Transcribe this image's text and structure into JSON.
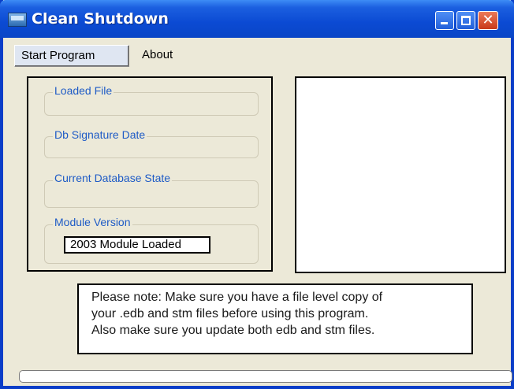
{
  "window": {
    "title": "Clean Shutdown"
  },
  "menu": {
    "start_program": "Start Program",
    "about": "About"
  },
  "fields": {
    "loaded_file": {
      "label": "Loaded File",
      "value": ""
    },
    "db_signature_date": {
      "label": "Db Signature Date",
      "value": ""
    },
    "current_database_state": {
      "label": "Current Database State",
      "value": ""
    },
    "module_version": {
      "label": "Module Version",
      "value": "2003 Module Loaded"
    }
  },
  "note": {
    "lines": [
      "Please note: Make sure you have a file level copy of",
      "your .edb and stm files before using this program.",
      "Also make sure you update both edb and stm files."
    ]
  },
  "progress": {
    "value": 0
  },
  "colors": {
    "titlebar": "#0a46c6",
    "label_blue": "#1e5bc6",
    "close": "#c8391a"
  },
  "icons": {
    "app": "app-window-icon",
    "minimize": "minimize-icon",
    "maximize": "maximize-icon",
    "close": "close-icon"
  }
}
